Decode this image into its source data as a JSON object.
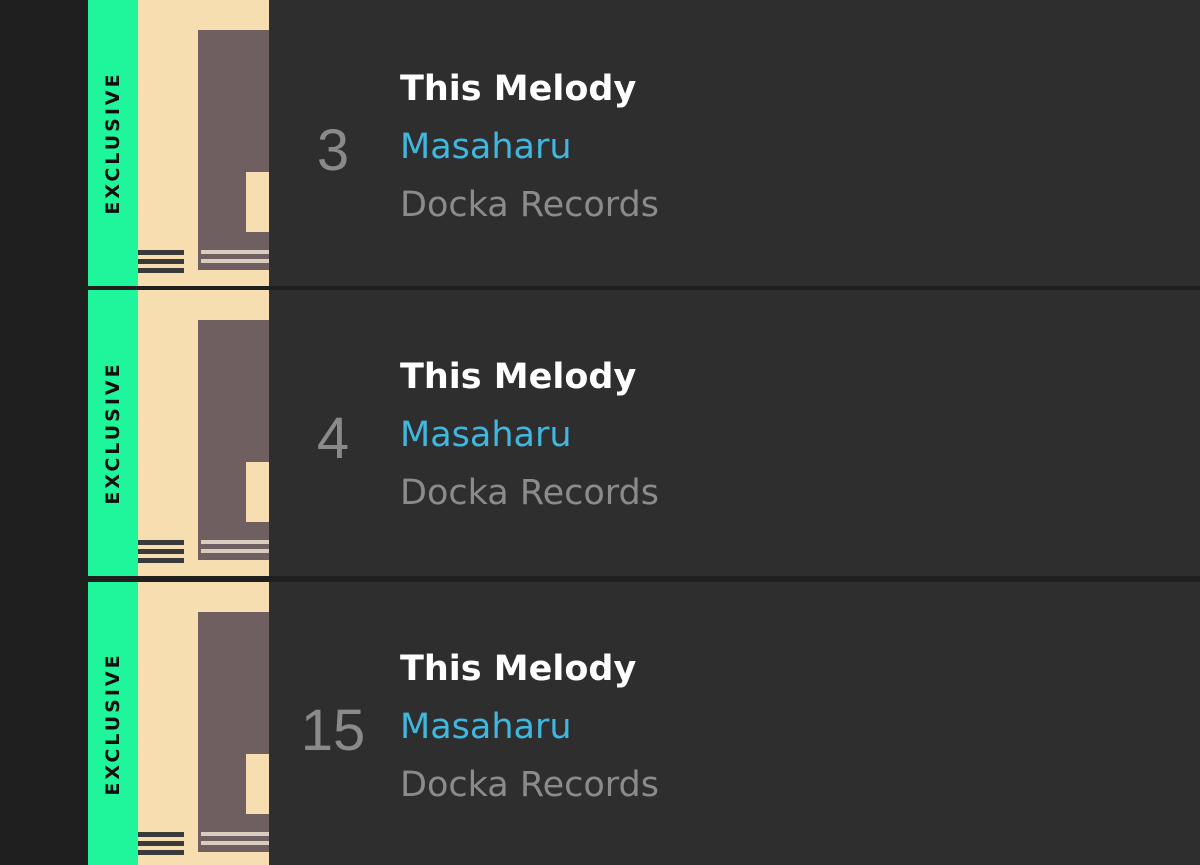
{
  "tracks": [
    {
      "rank": "3",
      "title": "This Melody",
      "artist": "Masaharu",
      "label": "Docka Records",
      "badge": "EXCLUSIVE",
      "art_icon": "album-art-this-melody"
    },
    {
      "rank": "4",
      "title": "This Melody",
      "artist": "Masaharu",
      "label": "Docka Records",
      "badge": "EXCLUSIVE",
      "art_icon": "album-art-this-melody"
    },
    {
      "rank": "15",
      "title": "This Melody",
      "artist": "Masaharu",
      "label": "Docka Records",
      "badge": "EXCLUSIVE",
      "art_icon": "album-art-this-melody"
    }
  ],
  "colors": {
    "background": "#1f1f1f",
    "row": "#2e2e2e",
    "exclusive_badge": "#1ff59a",
    "artist_link": "#3fb7df",
    "muted_text": "#8b8b8b",
    "title_text": "#ffffff"
  }
}
